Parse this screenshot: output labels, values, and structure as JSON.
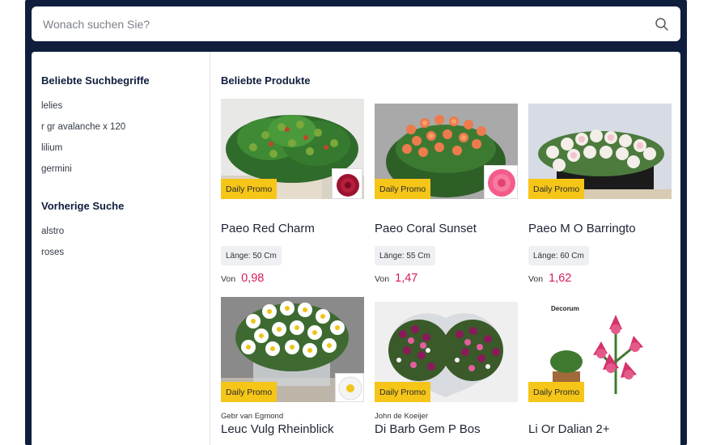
{
  "search": {
    "placeholder": "Wonach suchen Sie?"
  },
  "sidebar": {
    "popular_title": "Beliebte Suchbegriffe",
    "popular_items": [
      "lelies",
      "r gr avalanche x 120",
      "lilium",
      "germini"
    ],
    "recent_title": "Vorherige Suche",
    "recent_items": [
      "alstro",
      "roses"
    ]
  },
  "products": {
    "title": "Beliebte Produkte",
    "items": [
      {
        "name": "Paeo Red Charm",
        "promo": "Daily Promo",
        "length": "Länge: 50 Cm",
        "von": "Von",
        "price": "0,98",
        "brand": ""
      },
      {
        "name": "Paeo Coral Sunset",
        "promo": "Daily Promo",
        "length": "Länge: 55 Cm",
        "von": "Von",
        "price": "1,47",
        "brand": ""
      },
      {
        "name": "Paeo M O Barringto",
        "promo": "Daily Promo",
        "length": "Länge: 60 Cm",
        "von": "Von",
        "price": "1,62",
        "brand": ""
      },
      {
        "name": "Leuc Vulg Rheinblick",
        "promo": "Daily Promo",
        "brand": "Gebr van Egmond"
      },
      {
        "name": "Di Barb Gem P Bos",
        "promo": "Daily Promo",
        "brand": "John de Koeijer"
      },
      {
        "name": "Li Or Dalian 2+",
        "promo": "Daily Promo",
        "brand": "",
        "image_label": "Decorum"
      }
    ]
  },
  "colors": {
    "frame": "#0f1e3d",
    "promo": "#f5c518",
    "price": "#d81b60"
  }
}
